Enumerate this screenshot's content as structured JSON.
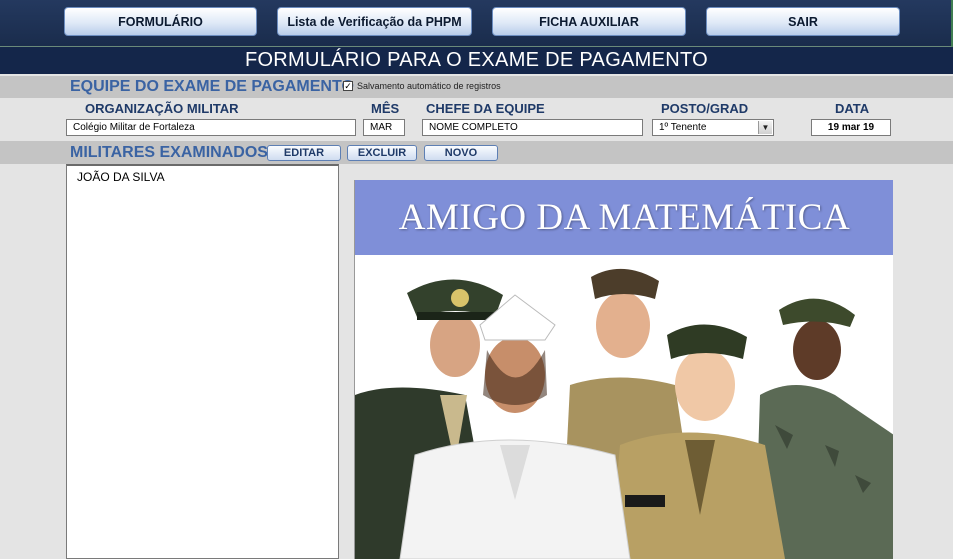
{
  "nav": {
    "formulario": "FORMULÁRIO",
    "lista": "Lista de Verificação da PHPM",
    "ficha": "FICHA AUXILIAR",
    "sair": "SAIR"
  },
  "page_title": "FORMULÁRIO PARA O EXAME DE PAGAMENTO",
  "team_section": {
    "title": "EQUIPE DO EXAME DE PAGAMENTO",
    "autosave_label": "Salvamento automático de registros",
    "autosave_checked": true,
    "org_label": "ORGANIZAÇÃO MILITAR",
    "org_value": "Colégio Militar de Fortaleza",
    "month_label": "MÊS",
    "month_value": "MAR",
    "chief_label": "CHEFE DA EQUIPE",
    "chief_value": "NOME COMPLETO",
    "rank_label": "POSTO/GRAD",
    "rank_value": "1º Tenente",
    "date_label": "DATA",
    "date_value": "19 mar 19"
  },
  "examined_section": {
    "title": "MILITARES EXAMINADOS",
    "edit_label": "EDITAR",
    "delete_label": "EXCLUIR",
    "new_label": "NOVO",
    "items": [
      "JOÃO DA SILVA"
    ]
  },
  "banner": {
    "title": "AMIGO DA MATEMÁTICA"
  },
  "colors": {
    "nav_bg": "#1f3356",
    "title_bg": "#14264a",
    "section_label": "#3a63a3",
    "banner_head": "#7f8fd8"
  }
}
